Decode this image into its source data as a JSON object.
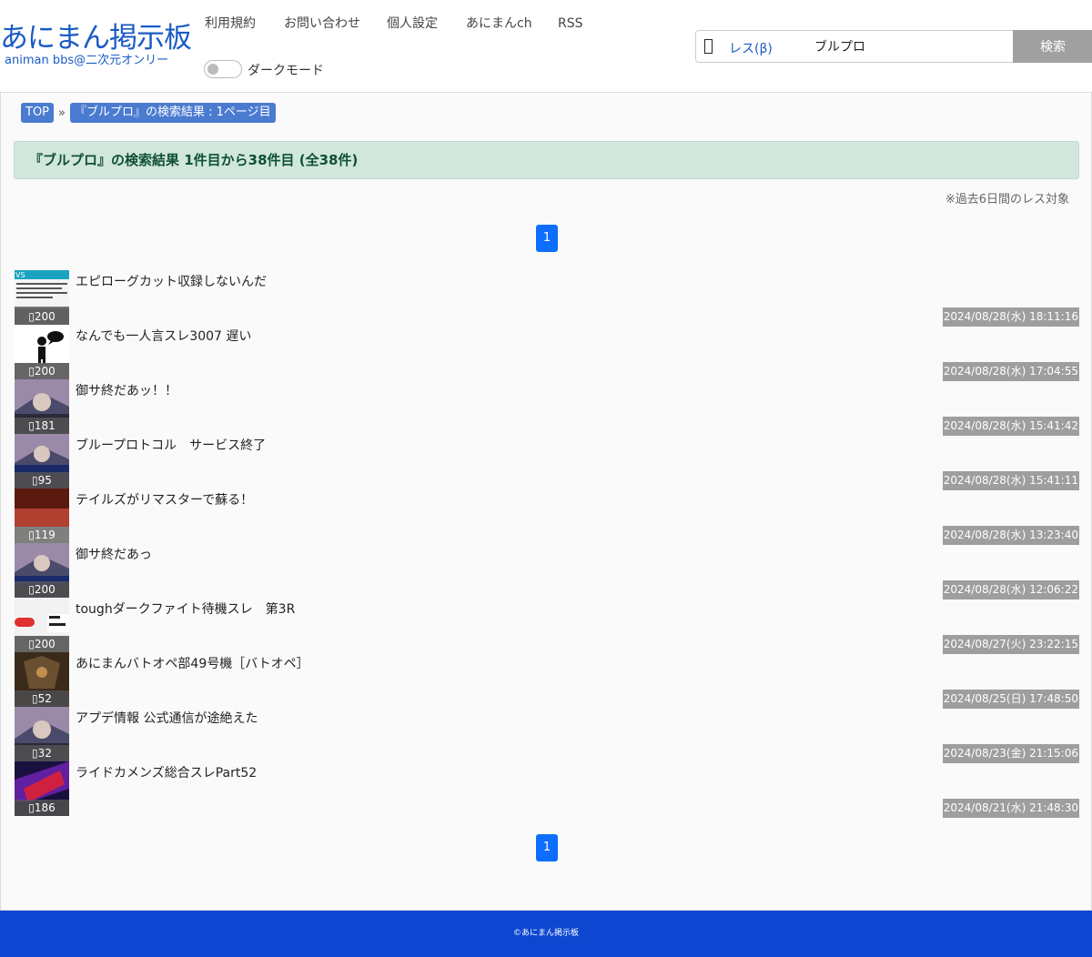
{
  "header": {
    "logo_title": "あにまん掲示板",
    "logo_subtitle": "animan bbs@二次元オンリー",
    "nav": [
      "利用規約",
      "お問い合わせ",
      "個人設定",
      "あにまんch",
      "RSS"
    ],
    "dark_mode_label": "ダークモード"
  },
  "search": {
    "mode_label": "レス(β)",
    "query": "ブルプロ",
    "button_label": "検索"
  },
  "breadcrumb": {
    "items": [
      "TOP",
      "『ブルプロ』の検索結果 : 1ページ目"
    ],
    "separator": "»"
  },
  "results": {
    "banner": "『ブルプロ』の検索結果 1件目から38件目 (全38件)",
    "note": "※過去6日間のレス対象",
    "page_top": "1",
    "page_bottom": "1"
  },
  "threads": [
    {
      "title": "エピローグカット収録しないんだ",
      "count": "200",
      "date": "2024/08/28(水) 18:11:16"
    },
    {
      "title": "なんでも一人言スレ3007 遅い",
      "count": "200",
      "date": "2024/08/28(水) 17:04:55"
    },
    {
      "title": "御サ終だあッ！！",
      "count": "181",
      "date": "2024/08/28(水) 15:41:42"
    },
    {
      "title": "ブループロトコル　サービス終了",
      "count": "95",
      "date": "2024/08/28(水) 15:41:11"
    },
    {
      "title": "テイルズがリマスターで蘇る！",
      "count": "119",
      "date": "2024/08/28(水) 13:23:40"
    },
    {
      "title": "御サ終だあっ",
      "count": "200",
      "date": "2024/08/28(水) 12:06:22"
    },
    {
      "title": "toughダークファイト待機スレ　第3R",
      "count": "200",
      "date": "2024/08/27(火) 23:22:15"
    },
    {
      "title": "あにまんバトオペ部49号機［バトオペ］",
      "count": "52",
      "date": "2024/08/25(日) 17:48:50"
    },
    {
      "title": "アプデ情報 公式通信が途絶えた",
      "count": "32",
      "date": "2024/08/23(金) 21:15:06"
    },
    {
      "title": "ライドカメンズ総合スレPart52",
      "count": "186",
      "date": "2024/08/21(水) 21:48:30"
    }
  ],
  "footer": {
    "copyright": "©あにまん掲示板"
  },
  "colors": {
    "brand": "#1a5bc4",
    "footer": "#0d47d1",
    "pager": "#0d6efd",
    "banner_bg": "#d1e7dd",
    "banner_text": "#0f5132",
    "date_badge": "#9e9e9e"
  }
}
